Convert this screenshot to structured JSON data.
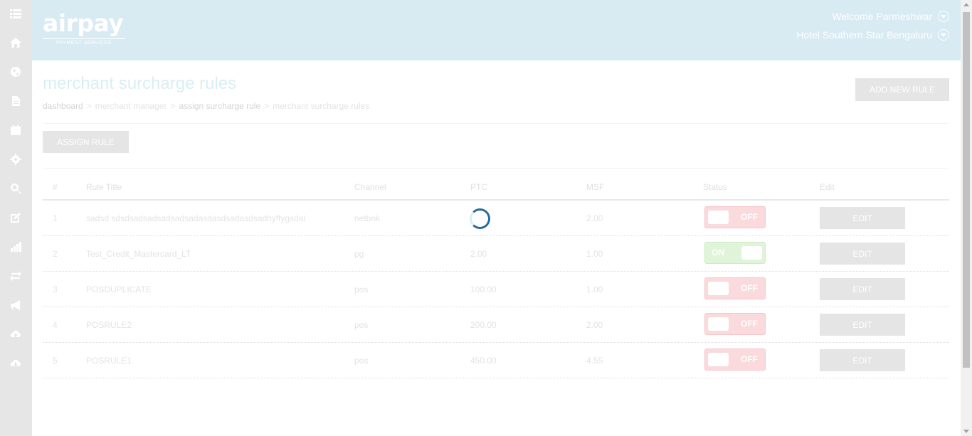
{
  "brand": {
    "logo_text": "airpay",
    "logo_subtext": "PAYMENT SERVICES"
  },
  "header": {
    "welcome": "Welcome Parmeshwar",
    "hotel": "Hotel Southern Star Bengaluru"
  },
  "page": {
    "title": "merchant surcharge rules",
    "add_button": "ADD NEW RULE",
    "assign_button": "ASSIGN RULE"
  },
  "breadcrumb": [
    "dashboard",
    ">",
    "merchant manager",
    ">",
    "assign surcharge rule",
    ">",
    "merchant surcharge rules"
  ],
  "sidebar": {
    "icons": [
      "menu-icon",
      "home-icon",
      "globe-icon",
      "document-icon",
      "calendar-icon",
      "gear-icon",
      "search-zoom-icon",
      "edit-icon",
      "bar-chart-icon",
      "refresh-icon",
      "megaphone-icon",
      "cloud-upload-icon",
      "cloud-download-icon"
    ]
  },
  "table": {
    "columns": [
      "#",
      "Rule Title",
      "Channel",
      "PTC",
      "MSF",
      "Status",
      "Edit"
    ],
    "rows": [
      {
        "num": "1",
        "title": "sadsd sdsdsadsadsadsadsadasdasdsadasdsadhyffygsdai",
        "channel": "netbnk",
        "ptc": "",
        "msf": "2.00",
        "status": "OFF",
        "edit": "EDIT"
      },
      {
        "num": "2",
        "title": "Test_Credit_Mastercard_LT",
        "channel": "pg",
        "ptc": "2.00",
        "msf": "1.00",
        "status": "ON",
        "edit": "EDIT"
      },
      {
        "num": "3",
        "title": "POSDUPLICATE",
        "channel": "pos",
        "ptc": "100.00",
        "msf": "1.00",
        "status": "OFF",
        "edit": "EDIT"
      },
      {
        "num": "4",
        "title": "POSRULE2",
        "channel": "pos",
        "ptc": "200.00",
        "msf": "2.00",
        "status": "OFF",
        "edit": "EDIT"
      },
      {
        "num": "5",
        "title": "POSRULE1",
        "channel": "pos",
        "ptc": "450.00",
        "msf": "4.55",
        "status": "OFF",
        "edit": "EDIT"
      }
    ]
  },
  "colors": {
    "header_bg": "#d8eaf2",
    "sidebar_bg": "#e6e6e6",
    "toggle_off": "#fadadd",
    "toggle_on": "#dff4d8",
    "spinner": "#2a6b9c"
  }
}
